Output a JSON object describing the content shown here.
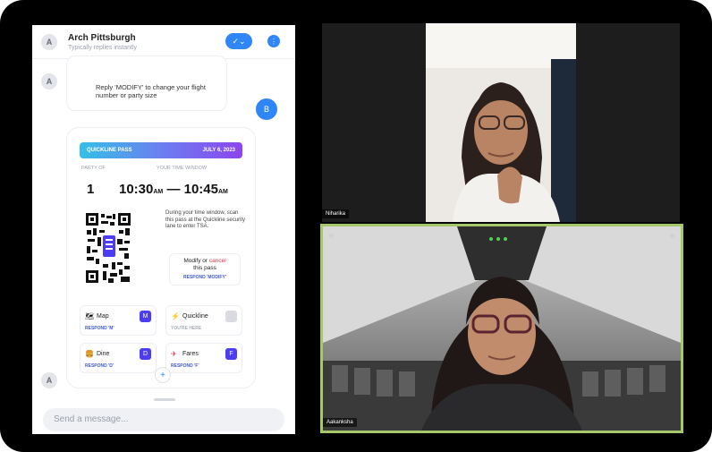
{
  "chat": {
    "avatar_letter": "A",
    "contact_name": "Arch Pittsburgh",
    "contact_status": "Typically replies instantly",
    "header_button_icon": "check-icon",
    "header_menu_icon": "dots-icon",
    "incoming_line1": "Reply 'MODIFY' to change your flight",
    "incoming_line2": "number or party size",
    "user_initial": "B",
    "pass": {
      "title": "QUICKLINE PASS",
      "date": "JULY 6, 2023",
      "party_label": "PARTY OF",
      "party_size": "1",
      "window_label": "YOUR TIME WINDOW",
      "time_start": "10:30",
      "time_start_ampm": "AM",
      "dash": "—",
      "time_end": "10:45",
      "time_end_ampm": "AM",
      "instructions": "During your time window, scan this pass at the Quickline security lane to enter TSA.",
      "modify_text": "Modify or",
      "cancel_text": "cancel",
      "this_pass": "this pass",
      "respond_text": "RESPOND 'MODIFY'"
    },
    "tiles": [
      {
        "icon": "map-icon",
        "glyph": "🗺",
        "label": "Map",
        "sub": "RESPOND 'M'",
        "key": "M"
      },
      {
        "icon": "lightning-icon",
        "glyph": "⚡",
        "label": "Quickline",
        "sub": "YOU'RE HERE",
        "key": ""
      },
      {
        "icon": "food-icon",
        "glyph": "🍔",
        "label": "Dine",
        "sub": "RESPOND 'D'",
        "key": "D"
      },
      {
        "icon": "plane-icon",
        "glyph": "✈",
        "label": "Fares",
        "sub": "RESPOND 'F'",
        "key": "F"
      }
    ],
    "scroll_icon": "plus-icon",
    "composer_placeholder": "Send a message..."
  },
  "video": {
    "top_name": "Niharika",
    "bottom_name": "Aakanksha",
    "active_border_color": "#a6c86b"
  }
}
